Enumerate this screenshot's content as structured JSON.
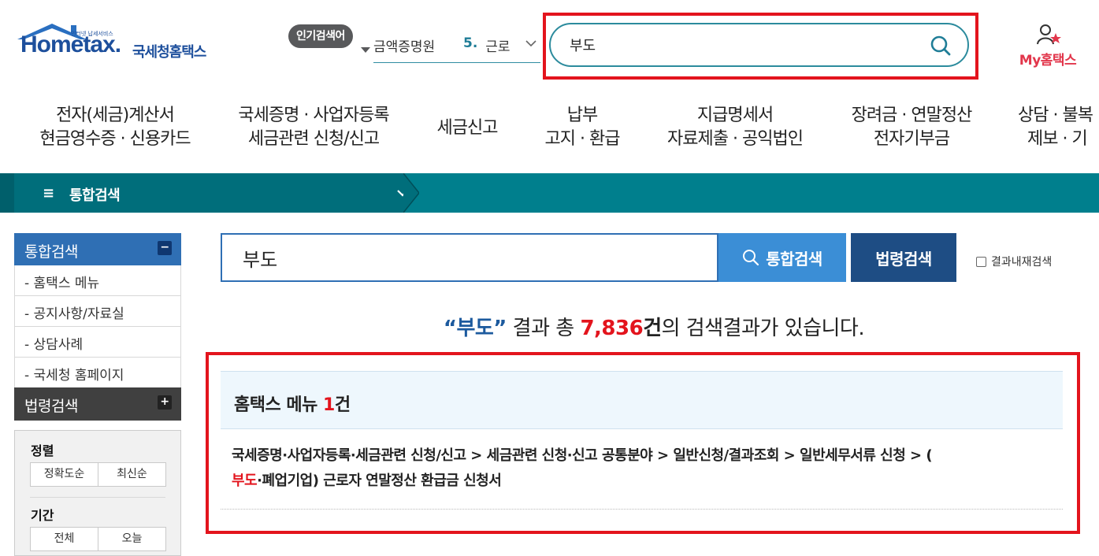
{
  "header": {
    "logo_text": "Hometax.",
    "logo_korean": "국세청홈택스",
    "logo_small": "인터넷 납세서비스",
    "popular_badge": "인기검색어",
    "ticker_prev": "금액증명원",
    "ticker_num": "5.",
    "ticker_word": "근로",
    "top_search_value": "부도",
    "my_hometax": "My홈택스"
  },
  "gnb": [
    {
      "line1": "전자(세금)계산서",
      "line2": "현금영수증 · 신용카드"
    },
    {
      "line1": "국세증명 · 사업자등록",
      "line2": "세금관련 신청/신고"
    },
    {
      "line1": "세금신고",
      "line2": ""
    },
    {
      "line1": "납부",
      "line2": "고지 · 환급"
    },
    {
      "line1": "지급명세서",
      "line2": "자료제출 · 공익법인"
    },
    {
      "line1": "장려금 · 연말정산",
      "line2": "전자기부금"
    },
    {
      "line1": "상담 · 불복",
      "line2": "제보 · 기"
    }
  ],
  "nav_bar": {
    "hamburger": "≡",
    "title": "통합검색"
  },
  "sidebar": {
    "unified_label": "통합검색",
    "unified_toggle": "−",
    "items": [
      "- 홈택스 메뉴",
      "- 공지사항/자료실",
      "- 상담사례",
      "- 국세청 홈페이지"
    ],
    "law_label": "법령검색",
    "law_toggle": "+",
    "sort_label": "정렬",
    "sort_options": [
      "정확도순",
      "최신순"
    ],
    "period_label": "기간",
    "period_options": [
      "전체",
      "오늘"
    ]
  },
  "search": {
    "value": "부도",
    "unified_button": "통합검색",
    "law_button": "법령검색",
    "within_label": "결과내재검색"
  },
  "summary": {
    "open_quote": "“부도”",
    "middle": " 결과 총 ",
    "count": "7,836",
    "unit": "건",
    "tail": "의 검색결과가 있습니다."
  },
  "result": {
    "section": "홈택스 메뉴 ",
    "count": "1",
    "unit": "건",
    "path_line": "국세증명·사업자등록·세금관련 신청/신고 > 세금관련 신청·신고 공통분야 > 일반신청/결과조회 > 일반세무서류 신청 > (",
    "highlight": "부도",
    "path_tail": "·폐업기업) 근로자 연말정산 환급금 신청서"
  },
  "colors": {
    "teal": "#007f8d",
    "blue": "#2f6fb4",
    "dark_blue": "#1e4d84",
    "highlight_red": "#e3141d"
  }
}
